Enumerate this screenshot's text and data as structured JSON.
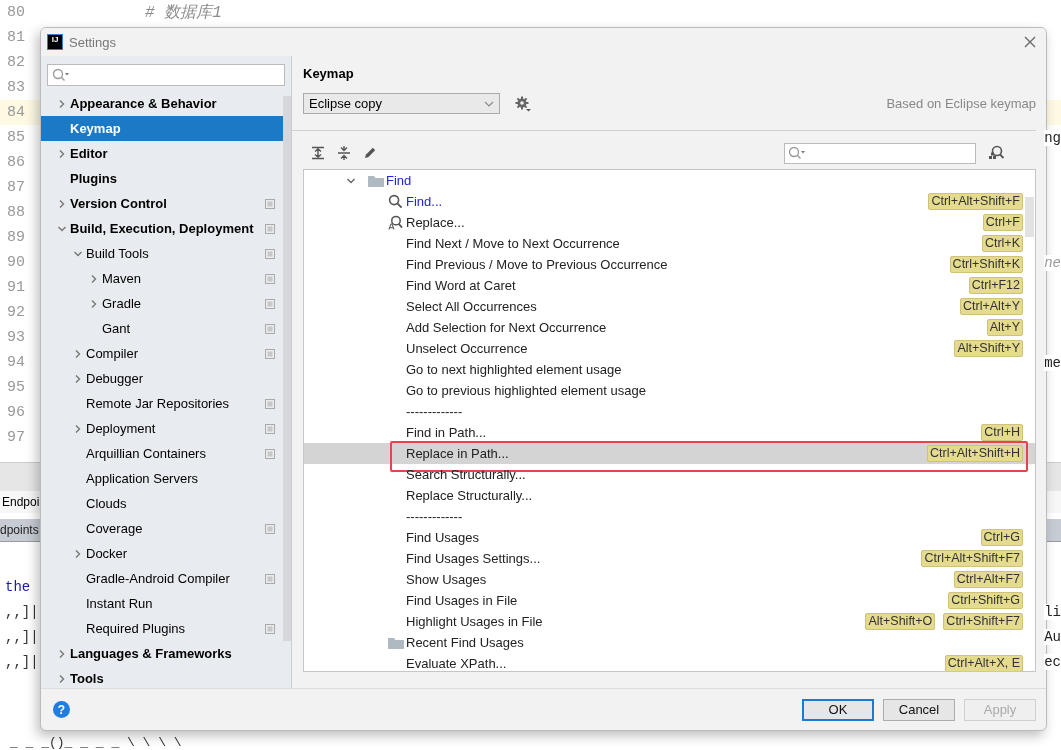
{
  "editor": {
    "lines": [
      {
        "number": "80",
        "code": "# 数据库1",
        "current": false
      },
      {
        "number": "81",
        "current": false
      },
      {
        "number": "82",
        "current": false
      },
      {
        "number": "83",
        "current": false
      },
      {
        "number": "84",
        "current": true
      },
      {
        "number": "85",
        "tail": "ng",
        "current": false
      },
      {
        "number": "86",
        "current": false
      },
      {
        "number": "87",
        "current": false
      },
      {
        "number": "88",
        "current": false
      },
      {
        "number": "89",
        "current": false
      },
      {
        "number": "90",
        "tail": "ne",
        "current": false
      },
      {
        "number": "91",
        "current": false
      },
      {
        "number": "92",
        "current": false
      },
      {
        "number": "93",
        "current": false
      },
      {
        "number": "94",
        "tail": "me",
        "current": false
      },
      {
        "number": "95",
        "current": false
      },
      {
        "number": "96",
        "current": false
      },
      {
        "number": "97",
        "current": false
      }
    ]
  },
  "tool_window": {
    "tab": "Endpoi",
    "subtab": "dpoints",
    "console": [
      {
        "text": "the"
      },
      {
        "text": ",,]|",
        "tail": "li"
      },
      {
        "text": ",,]|",
        "tail": "Au"
      },
      {
        "text": ",,]|",
        "tail": "ec"
      }
    ],
    "bottom_line": "_ _ _()_ _  _ _ \\ \\ \\ \\"
  },
  "dialog": {
    "logo": "IJ",
    "title": "Settings",
    "settings_tree": [
      {
        "label": "Appearance & Behavior",
        "expanded": false,
        "selected": false,
        "project_level": false
      },
      {
        "label": "Keymap",
        "selected": true,
        "project_level": false
      },
      {
        "label": "Editor",
        "expanded": false,
        "selected": false,
        "project_level": false
      },
      {
        "label": "Plugins",
        "selected": false,
        "project_level": false
      },
      {
        "label": "Version Control",
        "expanded": false,
        "selected": false,
        "project_level": true
      },
      {
        "label": "Build, Execution, Deployment",
        "expanded": true,
        "selected": false,
        "project_level": true,
        "children": [
          {
            "label": "Build Tools",
            "expanded": true,
            "selected": false,
            "project_level": true,
            "children": [
              {
                "label": "Maven",
                "expanded": false,
                "selected": false,
                "project_level": true
              },
              {
                "label": "Gradle",
                "expanded": false,
                "selected": false,
                "project_level": true
              },
              {
                "label": "Gant",
                "selected": false,
                "project_level": true
              }
            ]
          },
          {
            "label": "Compiler",
            "expanded": false,
            "selected": false,
            "project_level": true
          },
          {
            "label": "Debugger",
            "expanded": false,
            "selected": false,
            "project_level": false
          },
          {
            "label": "Remote Jar Repositories",
            "selected": false,
            "project_level": true
          },
          {
            "label": "Deployment",
            "expanded": false,
            "selected": false,
            "project_level": true
          },
          {
            "label": "Arquillian Containers",
            "selected": false,
            "project_level": true
          },
          {
            "label": "Application Servers",
            "selected": false,
            "project_level": false
          },
          {
            "label": "Clouds",
            "selected": false,
            "project_level": false
          },
          {
            "label": "Coverage",
            "selected": false,
            "project_level": true
          },
          {
            "label": "Docker",
            "expanded": false,
            "selected": false,
            "project_level": false
          },
          {
            "label": "Gradle-Android Compiler",
            "selected": false,
            "project_level": true
          },
          {
            "label": "Instant Run",
            "selected": false,
            "project_level": false
          },
          {
            "label": "Required Plugins",
            "selected": false,
            "project_level": true
          }
        ]
      },
      {
        "label": "Languages & Frameworks",
        "expanded": false,
        "selected": false,
        "project_level": false
      },
      {
        "label": "Tools",
        "expanded": false,
        "selected": false,
        "project_level": false
      }
    ],
    "page_title": "Keymap",
    "keymap_select": "Eclipse copy",
    "based_on": "Based on Eclipse keymap",
    "keymap_tree": [
      {
        "label": "Find",
        "kind": "folder",
        "expanded": true,
        "modified": true,
        "selected": false,
        "outlined": false,
        "children": [
          {
            "label": "Find...",
            "kind": "search",
            "modified": true,
            "selected": false,
            "outlined": false,
            "shortcuts": [
              "Ctrl+Alt+Shift+F"
            ]
          },
          {
            "label": "Replace...",
            "kind": "replace",
            "modified": false,
            "selected": false,
            "outlined": false,
            "shortcuts": [
              "Ctrl+F"
            ]
          },
          {
            "label": "Find Next / Move to Next Occurrence",
            "kind": "action",
            "modified": false,
            "selected": false,
            "outlined": false,
            "shortcuts": [
              "Ctrl+K"
            ]
          },
          {
            "label": "Find Previous / Move to Previous Occurrence",
            "kind": "action",
            "modified": false,
            "selected": false,
            "outlined": false,
            "shortcuts": [
              "Ctrl+Shift+K"
            ]
          },
          {
            "label": "Find Word at Caret",
            "kind": "action",
            "modified": false,
            "selected": false,
            "outlined": false,
            "shortcuts": [
              "Ctrl+F12"
            ]
          },
          {
            "label": "Select All Occurrences",
            "kind": "action",
            "modified": false,
            "selected": false,
            "outlined": false,
            "shortcuts": [
              "Ctrl+Alt+Y"
            ]
          },
          {
            "label": "Add Selection for Next Occurrence",
            "kind": "action",
            "modified": false,
            "selected": false,
            "outlined": false,
            "shortcuts": [
              "Alt+Y"
            ]
          },
          {
            "label": "Unselect Occurrence",
            "kind": "action",
            "modified": false,
            "selected": false,
            "outlined": false,
            "shortcuts": [
              "Alt+Shift+Y"
            ]
          },
          {
            "label": "Go to next highlighted element usage",
            "kind": "action",
            "modified": false,
            "selected": false,
            "outlined": false
          },
          {
            "label": "Go to previous highlighted element usage",
            "kind": "action",
            "modified": false,
            "selected": false,
            "outlined": false
          },
          {
            "label": "-------------",
            "kind": "action",
            "modified": false,
            "selected": false,
            "outlined": false
          },
          {
            "label": "Find in Path...",
            "kind": "action",
            "modified": false,
            "selected": false,
            "outlined": false,
            "shortcuts": [
              "Ctrl+H"
            ]
          },
          {
            "label": "Replace in Path...",
            "kind": "action",
            "modified": false,
            "selected": true,
            "outlined": true,
            "shortcuts": [
              "Ctrl+Alt+Shift+H"
            ]
          },
          {
            "label": "Search Structurally...",
            "kind": "action",
            "modified": false,
            "selected": false,
            "outlined": false
          },
          {
            "label": "Replace Structurally...",
            "kind": "action",
            "modified": false,
            "selected": false,
            "outlined": false
          },
          {
            "label": "-------------",
            "kind": "action",
            "modified": false,
            "selected": false,
            "outlined": false
          },
          {
            "label": "Find Usages",
            "kind": "action",
            "modified": false,
            "selected": false,
            "outlined": false,
            "shortcuts": [
              "Ctrl+G"
            ]
          },
          {
            "label": "Find Usages Settings...",
            "kind": "action",
            "modified": false,
            "selected": false,
            "outlined": false,
            "shortcuts": [
              "Ctrl+Alt+Shift+F7"
            ]
          },
          {
            "label": "Show Usages",
            "kind": "action",
            "modified": false,
            "selected": false,
            "outlined": false,
            "shortcuts": [
              "Ctrl+Alt+F7"
            ]
          },
          {
            "label": "Find Usages in File",
            "kind": "action",
            "modified": false,
            "selected": false,
            "outlined": false,
            "shortcuts": [
              "Ctrl+Shift+G"
            ]
          },
          {
            "label": "Highlight Usages in File",
            "kind": "action",
            "modified": false,
            "selected": false,
            "outlined": false,
            "shortcuts": [
              "Alt+Shift+O",
              "Ctrl+Shift+F7"
            ]
          },
          {
            "label": "Recent Find Usages",
            "kind": "folder",
            "modified": false,
            "selected": false,
            "outlined": false
          },
          {
            "label": "Evaluate XPath...",
            "kind": "action",
            "modified": false,
            "selected": false,
            "outlined": false,
            "shortcuts": [
              "Ctrl+Alt+X, E"
            ]
          }
        ]
      }
    ],
    "help": "?",
    "buttons": [
      {
        "label": "OK",
        "default": true,
        "disabled": false
      },
      {
        "label": "Cancel",
        "default": false,
        "disabled": false
      },
      {
        "label": "Apply",
        "default": false,
        "disabled": true
      }
    ]
  }
}
